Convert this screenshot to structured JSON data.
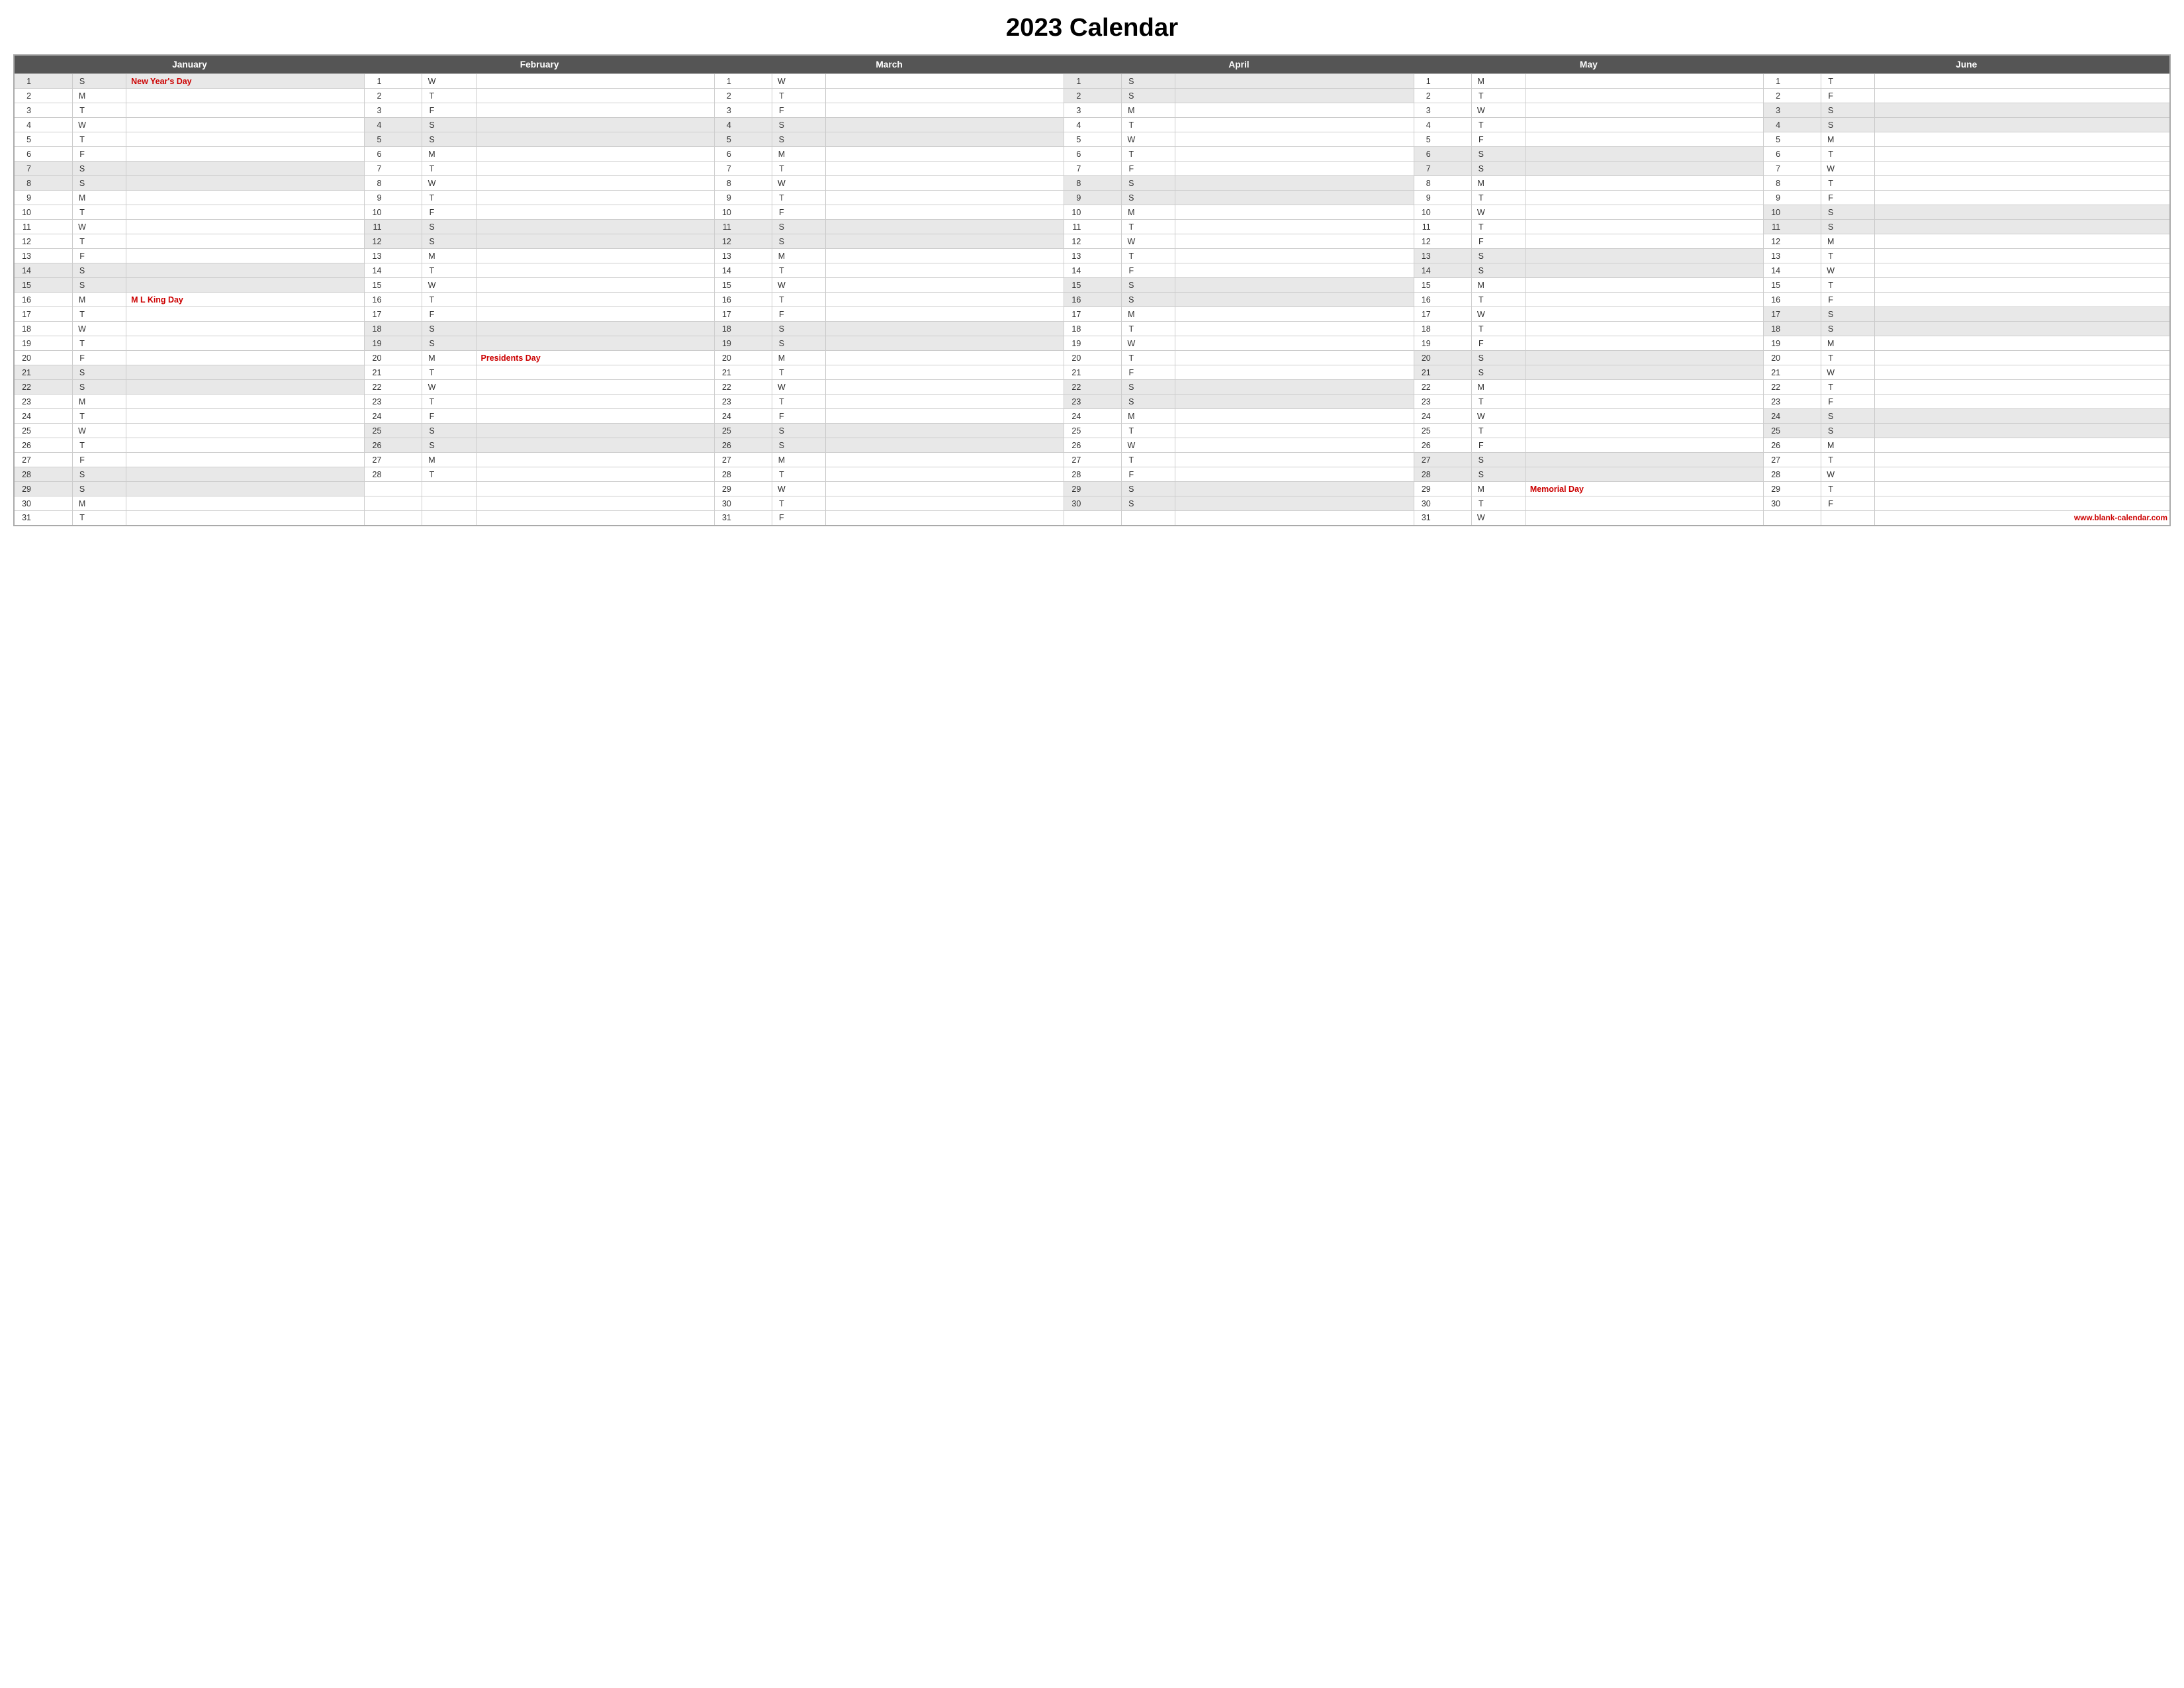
{
  "title": "2023 Calendar",
  "months": [
    "January",
    "February",
    "March",
    "April",
    "May",
    "June"
  ],
  "footer_link": "www.blank-calendar.com",
  "january": {
    "days": [
      {
        "n": 1,
        "d": "S",
        "holiday": "New Year's Day",
        "is_weekend": true
      },
      {
        "n": 2,
        "d": "M",
        "holiday": "",
        "is_weekend": false
      },
      {
        "n": 3,
        "d": "T",
        "holiday": "",
        "is_weekend": false
      },
      {
        "n": 4,
        "d": "W",
        "holiday": "",
        "is_weekend": false
      },
      {
        "n": 5,
        "d": "T",
        "holiday": "",
        "is_weekend": false
      },
      {
        "n": 6,
        "d": "F",
        "holiday": "",
        "is_weekend": false
      },
      {
        "n": 7,
        "d": "S",
        "holiday": "",
        "is_weekend": true
      },
      {
        "n": 8,
        "d": "S",
        "holiday": "",
        "is_weekend": true
      },
      {
        "n": 9,
        "d": "M",
        "holiday": "",
        "is_weekend": false
      },
      {
        "n": 10,
        "d": "T",
        "holiday": "",
        "is_weekend": false
      },
      {
        "n": 11,
        "d": "W",
        "holiday": "",
        "is_weekend": false
      },
      {
        "n": 12,
        "d": "T",
        "holiday": "",
        "is_weekend": false
      },
      {
        "n": 13,
        "d": "F",
        "holiday": "",
        "is_weekend": false
      },
      {
        "n": 14,
        "d": "S",
        "holiday": "",
        "is_weekend": true
      },
      {
        "n": 15,
        "d": "S",
        "holiday": "",
        "is_weekend": true
      },
      {
        "n": 16,
        "d": "M",
        "holiday": "M L King Day",
        "is_weekend": false
      },
      {
        "n": 17,
        "d": "T",
        "holiday": "",
        "is_weekend": false
      },
      {
        "n": 18,
        "d": "W",
        "holiday": "",
        "is_weekend": false
      },
      {
        "n": 19,
        "d": "T",
        "holiday": "",
        "is_weekend": false
      },
      {
        "n": 20,
        "d": "F",
        "holiday": "",
        "is_weekend": false
      },
      {
        "n": 21,
        "d": "S",
        "holiday": "",
        "is_weekend": true
      },
      {
        "n": 22,
        "d": "S",
        "holiday": "",
        "is_weekend": true
      },
      {
        "n": 23,
        "d": "M",
        "holiday": "",
        "is_weekend": false
      },
      {
        "n": 24,
        "d": "T",
        "holiday": "",
        "is_weekend": false
      },
      {
        "n": 25,
        "d": "W",
        "holiday": "",
        "is_weekend": false
      },
      {
        "n": 26,
        "d": "T",
        "holiday": "",
        "is_weekend": false
      },
      {
        "n": 27,
        "d": "F",
        "holiday": "",
        "is_weekend": false
      },
      {
        "n": 28,
        "d": "S",
        "holiday": "",
        "is_weekend": true
      },
      {
        "n": 29,
        "d": "S",
        "holiday": "",
        "is_weekend": true
      },
      {
        "n": 30,
        "d": "M",
        "holiday": "",
        "is_weekend": false
      },
      {
        "n": 31,
        "d": "T",
        "holiday": "",
        "is_weekend": false
      }
    ]
  },
  "february": {
    "days": [
      {
        "n": 1,
        "d": "W",
        "holiday": "",
        "is_weekend": false
      },
      {
        "n": 2,
        "d": "T",
        "holiday": "",
        "is_weekend": false
      },
      {
        "n": 3,
        "d": "F",
        "holiday": "",
        "is_weekend": false
      },
      {
        "n": 4,
        "d": "S",
        "holiday": "",
        "is_weekend": true
      },
      {
        "n": 5,
        "d": "S",
        "holiday": "",
        "is_weekend": true
      },
      {
        "n": 6,
        "d": "M",
        "holiday": "",
        "is_weekend": false
      },
      {
        "n": 7,
        "d": "T",
        "holiday": "",
        "is_weekend": false
      },
      {
        "n": 8,
        "d": "W",
        "holiday": "",
        "is_weekend": false
      },
      {
        "n": 9,
        "d": "T",
        "holiday": "",
        "is_weekend": false
      },
      {
        "n": 10,
        "d": "F",
        "holiday": "",
        "is_weekend": false
      },
      {
        "n": 11,
        "d": "S",
        "holiday": "",
        "is_weekend": true
      },
      {
        "n": 12,
        "d": "S",
        "holiday": "",
        "is_weekend": true
      },
      {
        "n": 13,
        "d": "M",
        "holiday": "",
        "is_weekend": false
      },
      {
        "n": 14,
        "d": "T",
        "holiday": "",
        "is_weekend": false
      },
      {
        "n": 15,
        "d": "W",
        "holiday": "",
        "is_weekend": false
      },
      {
        "n": 16,
        "d": "T",
        "holiday": "",
        "is_weekend": false
      },
      {
        "n": 17,
        "d": "F",
        "holiday": "",
        "is_weekend": false
      },
      {
        "n": 18,
        "d": "S",
        "holiday": "",
        "is_weekend": true
      },
      {
        "n": 19,
        "d": "S",
        "holiday": "",
        "is_weekend": true
      },
      {
        "n": 20,
        "d": "M",
        "holiday": "Presidents Day",
        "is_weekend": false
      },
      {
        "n": 21,
        "d": "T",
        "holiday": "",
        "is_weekend": false
      },
      {
        "n": 22,
        "d": "W",
        "holiday": "",
        "is_weekend": false
      },
      {
        "n": 23,
        "d": "T",
        "holiday": "",
        "is_weekend": false
      },
      {
        "n": 24,
        "d": "F",
        "holiday": "",
        "is_weekend": false
      },
      {
        "n": 25,
        "d": "S",
        "holiday": "",
        "is_weekend": true
      },
      {
        "n": 26,
        "d": "S",
        "holiday": "",
        "is_weekend": true
      },
      {
        "n": 27,
        "d": "M",
        "holiday": "",
        "is_weekend": false
      },
      {
        "n": 28,
        "d": "T",
        "holiday": "",
        "is_weekend": false
      }
    ]
  },
  "march": {
    "days": [
      {
        "n": 1,
        "d": "W",
        "holiday": "",
        "is_weekend": false
      },
      {
        "n": 2,
        "d": "T",
        "holiday": "",
        "is_weekend": false
      },
      {
        "n": 3,
        "d": "F",
        "holiday": "",
        "is_weekend": false
      },
      {
        "n": 4,
        "d": "S",
        "holiday": "",
        "is_weekend": true
      },
      {
        "n": 5,
        "d": "S",
        "holiday": "",
        "is_weekend": true
      },
      {
        "n": 6,
        "d": "M",
        "holiday": "",
        "is_weekend": false
      },
      {
        "n": 7,
        "d": "T",
        "holiday": "",
        "is_weekend": false
      },
      {
        "n": 8,
        "d": "W",
        "holiday": "",
        "is_weekend": false
      },
      {
        "n": 9,
        "d": "T",
        "holiday": "",
        "is_weekend": false
      },
      {
        "n": 10,
        "d": "F",
        "holiday": "",
        "is_weekend": false
      },
      {
        "n": 11,
        "d": "S",
        "holiday": "",
        "is_weekend": true
      },
      {
        "n": 12,
        "d": "S",
        "holiday": "",
        "is_weekend": true
      },
      {
        "n": 13,
        "d": "M",
        "holiday": "",
        "is_weekend": false
      },
      {
        "n": 14,
        "d": "T",
        "holiday": "",
        "is_weekend": false
      },
      {
        "n": 15,
        "d": "W",
        "holiday": "",
        "is_weekend": false
      },
      {
        "n": 16,
        "d": "T",
        "holiday": "",
        "is_weekend": false
      },
      {
        "n": 17,
        "d": "F",
        "holiday": "",
        "is_weekend": false
      },
      {
        "n": 18,
        "d": "S",
        "holiday": "",
        "is_weekend": true
      },
      {
        "n": 19,
        "d": "S",
        "holiday": "",
        "is_weekend": true
      },
      {
        "n": 20,
        "d": "M",
        "holiday": "",
        "is_weekend": false
      },
      {
        "n": 21,
        "d": "T",
        "holiday": "",
        "is_weekend": false
      },
      {
        "n": 22,
        "d": "W",
        "holiday": "",
        "is_weekend": false
      },
      {
        "n": 23,
        "d": "T",
        "holiday": "",
        "is_weekend": false
      },
      {
        "n": 24,
        "d": "F",
        "holiday": "",
        "is_weekend": false
      },
      {
        "n": 25,
        "d": "S",
        "holiday": "",
        "is_weekend": true
      },
      {
        "n": 26,
        "d": "S",
        "holiday": "",
        "is_weekend": true
      },
      {
        "n": 27,
        "d": "M",
        "holiday": "",
        "is_weekend": false
      },
      {
        "n": 28,
        "d": "T",
        "holiday": "",
        "is_weekend": false
      },
      {
        "n": 29,
        "d": "W",
        "holiday": "",
        "is_weekend": false
      },
      {
        "n": 30,
        "d": "T",
        "holiday": "",
        "is_weekend": false
      },
      {
        "n": 31,
        "d": "F",
        "holiday": "",
        "is_weekend": false
      }
    ]
  },
  "april": {
    "days": [
      {
        "n": 1,
        "d": "S",
        "holiday": "",
        "is_weekend": true
      },
      {
        "n": 2,
        "d": "S",
        "holiday": "",
        "is_weekend": true
      },
      {
        "n": 3,
        "d": "M",
        "holiday": "",
        "is_weekend": false
      },
      {
        "n": 4,
        "d": "T",
        "holiday": "",
        "is_weekend": false
      },
      {
        "n": 5,
        "d": "W",
        "holiday": "",
        "is_weekend": false
      },
      {
        "n": 6,
        "d": "T",
        "holiday": "",
        "is_weekend": false
      },
      {
        "n": 7,
        "d": "F",
        "holiday": "",
        "is_weekend": false
      },
      {
        "n": 8,
        "d": "S",
        "holiday": "",
        "is_weekend": true
      },
      {
        "n": 9,
        "d": "S",
        "holiday": "",
        "is_weekend": true
      },
      {
        "n": 10,
        "d": "M",
        "holiday": "",
        "is_weekend": false
      },
      {
        "n": 11,
        "d": "T",
        "holiday": "",
        "is_weekend": false
      },
      {
        "n": 12,
        "d": "W",
        "holiday": "",
        "is_weekend": false
      },
      {
        "n": 13,
        "d": "T",
        "holiday": "",
        "is_weekend": false
      },
      {
        "n": 14,
        "d": "F",
        "holiday": "",
        "is_weekend": false
      },
      {
        "n": 15,
        "d": "S",
        "holiday": "",
        "is_weekend": true
      },
      {
        "n": 16,
        "d": "S",
        "holiday": "",
        "is_weekend": true
      },
      {
        "n": 17,
        "d": "M",
        "holiday": "",
        "is_weekend": false
      },
      {
        "n": 18,
        "d": "T",
        "holiday": "",
        "is_weekend": false
      },
      {
        "n": 19,
        "d": "W",
        "holiday": "",
        "is_weekend": false
      },
      {
        "n": 20,
        "d": "T",
        "holiday": "",
        "is_weekend": false
      },
      {
        "n": 21,
        "d": "F",
        "holiday": "",
        "is_weekend": false
      },
      {
        "n": 22,
        "d": "S",
        "holiday": "",
        "is_weekend": true
      },
      {
        "n": 23,
        "d": "S",
        "holiday": "",
        "is_weekend": true
      },
      {
        "n": 24,
        "d": "M",
        "holiday": "",
        "is_weekend": false
      },
      {
        "n": 25,
        "d": "T",
        "holiday": "",
        "is_weekend": false
      },
      {
        "n": 26,
        "d": "W",
        "holiday": "",
        "is_weekend": false
      },
      {
        "n": 27,
        "d": "T",
        "holiday": "",
        "is_weekend": false
      },
      {
        "n": 28,
        "d": "F",
        "holiday": "",
        "is_weekend": false
      },
      {
        "n": 29,
        "d": "S",
        "holiday": "",
        "is_weekend": true
      },
      {
        "n": 30,
        "d": "S",
        "holiday": "",
        "is_weekend": true
      }
    ]
  },
  "may": {
    "days": [
      {
        "n": 1,
        "d": "M",
        "holiday": "",
        "is_weekend": false
      },
      {
        "n": 2,
        "d": "T",
        "holiday": "",
        "is_weekend": false
      },
      {
        "n": 3,
        "d": "W",
        "holiday": "",
        "is_weekend": false
      },
      {
        "n": 4,
        "d": "T",
        "holiday": "",
        "is_weekend": false
      },
      {
        "n": 5,
        "d": "F",
        "holiday": "",
        "is_weekend": false
      },
      {
        "n": 6,
        "d": "S",
        "holiday": "",
        "is_weekend": true
      },
      {
        "n": 7,
        "d": "S",
        "holiday": "",
        "is_weekend": true
      },
      {
        "n": 8,
        "d": "M",
        "holiday": "",
        "is_weekend": false
      },
      {
        "n": 9,
        "d": "T",
        "holiday": "",
        "is_weekend": false
      },
      {
        "n": 10,
        "d": "W",
        "holiday": "",
        "is_weekend": false
      },
      {
        "n": 11,
        "d": "T",
        "holiday": "",
        "is_weekend": false
      },
      {
        "n": 12,
        "d": "F",
        "holiday": "",
        "is_weekend": false
      },
      {
        "n": 13,
        "d": "S",
        "holiday": "",
        "is_weekend": true
      },
      {
        "n": 14,
        "d": "S",
        "holiday": "",
        "is_weekend": true
      },
      {
        "n": 15,
        "d": "M",
        "holiday": "",
        "is_weekend": false
      },
      {
        "n": 16,
        "d": "T",
        "holiday": "",
        "is_weekend": false
      },
      {
        "n": 17,
        "d": "W",
        "holiday": "",
        "is_weekend": false
      },
      {
        "n": 18,
        "d": "T",
        "holiday": "",
        "is_weekend": false
      },
      {
        "n": 19,
        "d": "F",
        "holiday": "",
        "is_weekend": false
      },
      {
        "n": 20,
        "d": "S",
        "holiday": "",
        "is_weekend": true
      },
      {
        "n": 21,
        "d": "S",
        "holiday": "",
        "is_weekend": true
      },
      {
        "n": 22,
        "d": "M",
        "holiday": "",
        "is_weekend": false
      },
      {
        "n": 23,
        "d": "T",
        "holiday": "",
        "is_weekend": false
      },
      {
        "n": 24,
        "d": "W",
        "holiday": "",
        "is_weekend": false
      },
      {
        "n": 25,
        "d": "T",
        "holiday": "",
        "is_weekend": false
      },
      {
        "n": 26,
        "d": "F",
        "holiday": "",
        "is_weekend": false
      },
      {
        "n": 27,
        "d": "S",
        "holiday": "",
        "is_weekend": true
      },
      {
        "n": 28,
        "d": "S",
        "holiday": "",
        "is_weekend": true
      },
      {
        "n": 29,
        "d": "M",
        "holiday": "Memorial Day",
        "is_weekend": false
      },
      {
        "n": 30,
        "d": "T",
        "holiday": "",
        "is_weekend": false
      },
      {
        "n": 31,
        "d": "W",
        "holiday": "",
        "is_weekend": false
      }
    ]
  },
  "june": {
    "days": [
      {
        "n": 1,
        "d": "T",
        "holiday": "",
        "is_weekend": false
      },
      {
        "n": 2,
        "d": "F",
        "holiday": "",
        "is_weekend": false
      },
      {
        "n": 3,
        "d": "S",
        "holiday": "",
        "is_weekend": true
      },
      {
        "n": 4,
        "d": "S",
        "holiday": "",
        "is_weekend": true
      },
      {
        "n": 5,
        "d": "M",
        "holiday": "",
        "is_weekend": false
      },
      {
        "n": 6,
        "d": "T",
        "holiday": "",
        "is_weekend": false
      },
      {
        "n": 7,
        "d": "W",
        "holiday": "",
        "is_weekend": false
      },
      {
        "n": 8,
        "d": "T",
        "holiday": "",
        "is_weekend": false
      },
      {
        "n": 9,
        "d": "F",
        "holiday": "",
        "is_weekend": false
      },
      {
        "n": 10,
        "d": "S",
        "holiday": "",
        "is_weekend": true
      },
      {
        "n": 11,
        "d": "S",
        "holiday": "",
        "is_weekend": true
      },
      {
        "n": 12,
        "d": "M",
        "holiday": "",
        "is_weekend": false
      },
      {
        "n": 13,
        "d": "T",
        "holiday": "",
        "is_weekend": false
      },
      {
        "n": 14,
        "d": "W",
        "holiday": "",
        "is_weekend": false
      },
      {
        "n": 15,
        "d": "T",
        "holiday": "",
        "is_weekend": false
      },
      {
        "n": 16,
        "d": "F",
        "holiday": "",
        "is_weekend": false
      },
      {
        "n": 17,
        "d": "S",
        "holiday": "",
        "is_weekend": true
      },
      {
        "n": 18,
        "d": "S",
        "holiday": "",
        "is_weekend": true
      },
      {
        "n": 19,
        "d": "M",
        "holiday": "",
        "is_weekend": false
      },
      {
        "n": 20,
        "d": "T",
        "holiday": "",
        "is_weekend": false
      },
      {
        "n": 21,
        "d": "W",
        "holiday": "",
        "is_weekend": false
      },
      {
        "n": 22,
        "d": "T",
        "holiday": "",
        "is_weekend": false
      },
      {
        "n": 23,
        "d": "F",
        "holiday": "",
        "is_weekend": false
      },
      {
        "n": 24,
        "d": "S",
        "holiday": "",
        "is_weekend": true
      },
      {
        "n": 25,
        "d": "S",
        "holiday": "",
        "is_weekend": true
      },
      {
        "n": 26,
        "d": "M",
        "holiday": "",
        "is_weekend": false
      },
      {
        "n": 27,
        "d": "T",
        "holiday": "",
        "is_weekend": false
      },
      {
        "n": 28,
        "d": "W",
        "holiday": "",
        "is_weekend": false
      },
      {
        "n": 29,
        "d": "T",
        "holiday": "",
        "is_weekend": false
      },
      {
        "n": 30,
        "d": "F",
        "holiday": "",
        "is_weekend": false
      }
    ]
  }
}
